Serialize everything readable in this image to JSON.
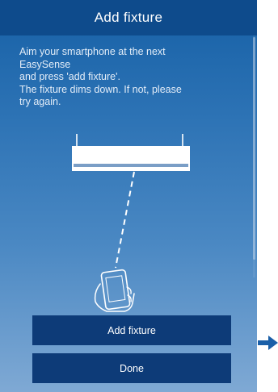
{
  "header": {
    "title": "Add fixture"
  },
  "instructions": {
    "lines": [
      "Aim your smartphone at the next",
      "EasySense",
      "and press 'add fixture'.",
      "The fixture dims down. If not, please",
      "try again."
    ]
  },
  "illustration": {
    "fixture_icon": "ceiling-fixture-icon",
    "phone_icon": "hand-holding-phone-icon",
    "beam": "dashed-line"
  },
  "buttons": {
    "add_fixture_label": "Add fixture",
    "done_label": "Done"
  },
  "navigation": {
    "next_icon": "arrow-right-icon"
  },
  "colors": {
    "title_bar": "#0e4b8c",
    "button": "#0d3b78",
    "gradient_top": "#1660a6",
    "gradient_bottom": "#7fa9d4",
    "arrow": "#1a5fa8"
  }
}
